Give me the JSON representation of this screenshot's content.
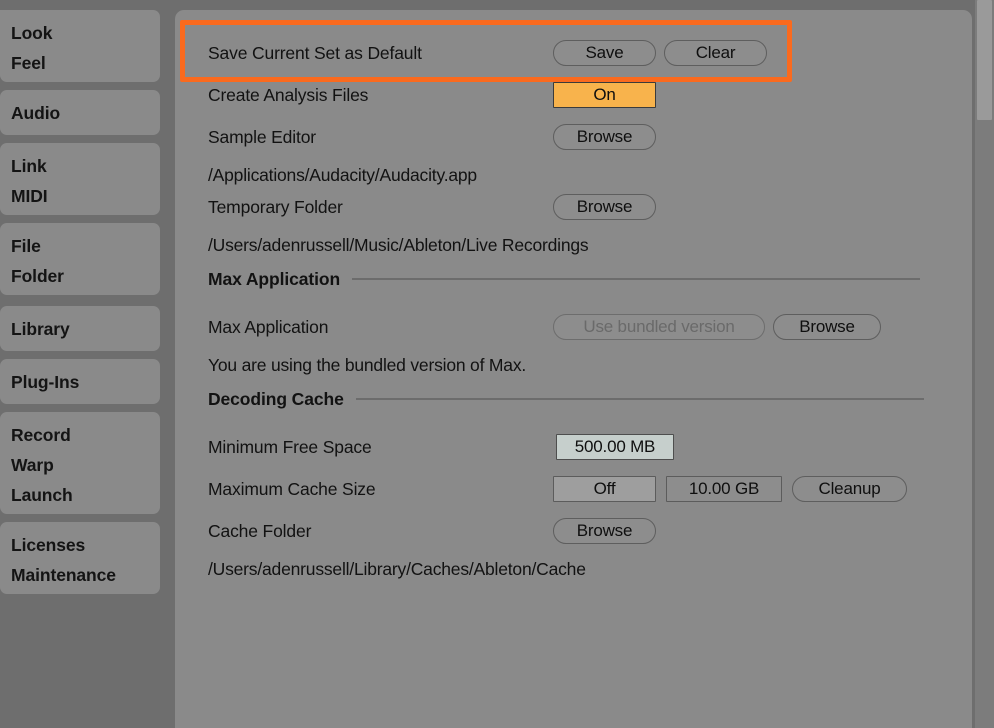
{
  "sidebar": {
    "groups": [
      {
        "items": [
          "Look",
          "Feel"
        ]
      },
      {
        "items": [
          "Audio"
        ]
      },
      {
        "items": [
          "Link",
          "MIDI"
        ]
      },
      {
        "items": [
          "File",
          "Folder"
        ]
      },
      {
        "items": [
          "Library"
        ]
      },
      {
        "items": [
          "Plug-Ins"
        ]
      },
      {
        "items": [
          "Record",
          "Warp",
          "Launch"
        ]
      },
      {
        "items": [
          "Licenses",
          "Maintenance"
        ]
      }
    ]
  },
  "main": {
    "rows": {
      "save_default": {
        "label": "Save Current Set as Default",
        "save_button": "Save",
        "clear_button": "Clear"
      },
      "create_analysis": {
        "label": "Create Analysis Files",
        "value": "On"
      },
      "sample_editor": {
        "label": "Sample Editor",
        "browse_button": "Browse",
        "path": "/Applications/Audacity/Audacity.app"
      },
      "temporary_folder": {
        "label": "Temporary Folder",
        "browse_button": "Browse",
        "path": "/Users/adenrussell/Music/Ableton/Live Recordings"
      }
    },
    "max_application": {
      "section_title": "Max Application",
      "label": "Max Application",
      "bundled_button": "Use bundled version",
      "browse_button": "Browse",
      "note": "You are using the bundled version of Max."
    },
    "decoding_cache": {
      "section_title": "Decoding Cache",
      "min_free_space": {
        "label": "Minimum Free Space",
        "value": "500.00 MB"
      },
      "max_cache_size": {
        "label": "Maximum Cache Size",
        "toggle": "Off",
        "value": "10.00 GB",
        "cleanup_button": "Cleanup"
      },
      "cache_folder": {
        "label": "Cache Folder",
        "browse_button": "Browse",
        "path": "/Users/adenrussell/Library/Caches/Ableton/Cache"
      }
    }
  },
  "colors": {
    "accent_highlight": "#fa6a1e",
    "toggle_on": "#f8b34c",
    "panel_bg": "#8a8a8a",
    "sidebar_bg": "#6e6e6e",
    "field_selected": "#c6cfcc"
  }
}
